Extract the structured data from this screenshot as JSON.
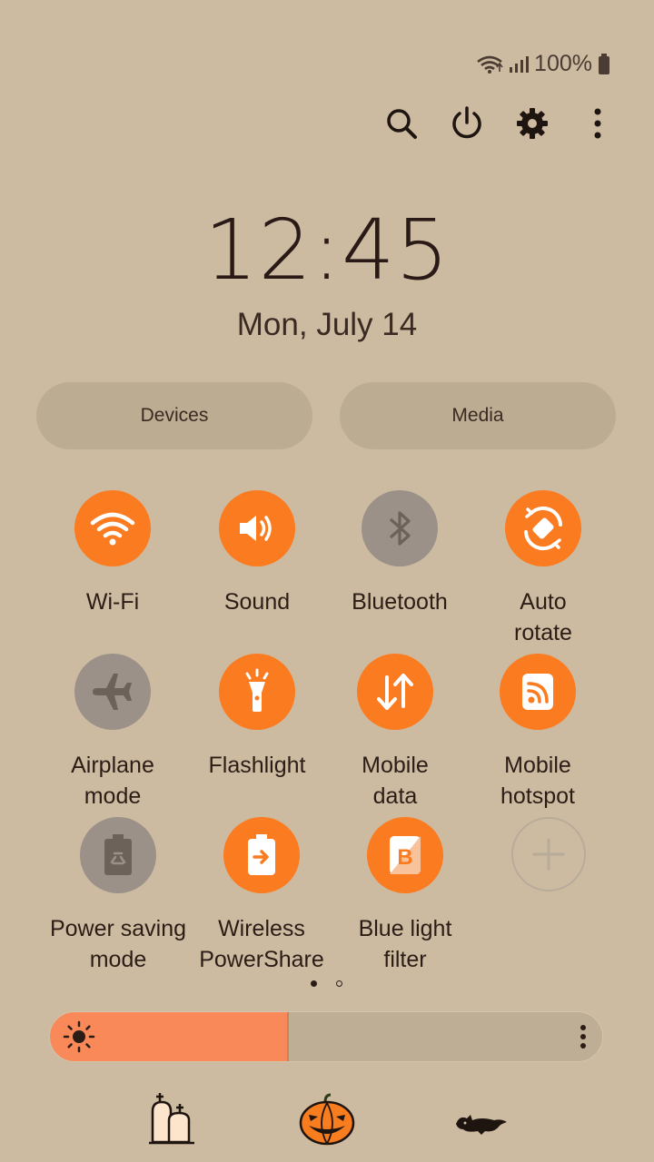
{
  "status_bar": {
    "battery_text": "100%",
    "icons": [
      "wifi-icon",
      "signal-icon",
      "battery-icon"
    ]
  },
  "top_actions": [
    "search-icon",
    "power-icon",
    "settings-icon",
    "more-icon"
  ],
  "clock": {
    "time": "12:45",
    "date": "Mon, July 14"
  },
  "pills": {
    "devices": "Devices",
    "media": "Media"
  },
  "tiles": [
    {
      "label": "Wi-Fi",
      "state": "on",
      "icon": "wifi-icon"
    },
    {
      "label": "Sound",
      "state": "on",
      "icon": "sound-icon"
    },
    {
      "label": "Bluetooth",
      "state": "off",
      "icon": "bluetooth-icon"
    },
    {
      "label": "Auto\nrotate",
      "state": "on",
      "icon": "auto-rotate-icon"
    },
    {
      "label": "Airplane\nmode",
      "state": "off",
      "icon": "airplane-icon"
    },
    {
      "label": "Flashlight",
      "state": "on",
      "icon": "flashlight-icon"
    },
    {
      "label": "Mobile\ndata",
      "state": "on",
      "icon": "mobile-data-icon"
    },
    {
      "label": "Mobile\nhotspot",
      "state": "on",
      "icon": "hotspot-icon"
    },
    {
      "label": "Power saving\nmode",
      "state": "off",
      "icon": "power-saving-icon"
    },
    {
      "label": "Wireless\nPowerShare",
      "state": "on",
      "icon": "wireless-powershare-icon"
    },
    {
      "label": "Blue light\nfilter",
      "state": "on",
      "icon": "blue-light-filter-icon"
    },
    {
      "label": "",
      "state": "add",
      "icon": "add-icon"
    }
  ],
  "pages": {
    "count": 2,
    "current": 1
  },
  "brightness": {
    "level_percent": 43
  },
  "colors": {
    "background": "#cdbba1",
    "accent_on": "#fb7b20",
    "tile_off": "#9b9189",
    "brightness_fill": "#f98958"
  },
  "stickers": [
    "gravestones-icon",
    "pumpkin-icon",
    "black-cat-icon"
  ]
}
